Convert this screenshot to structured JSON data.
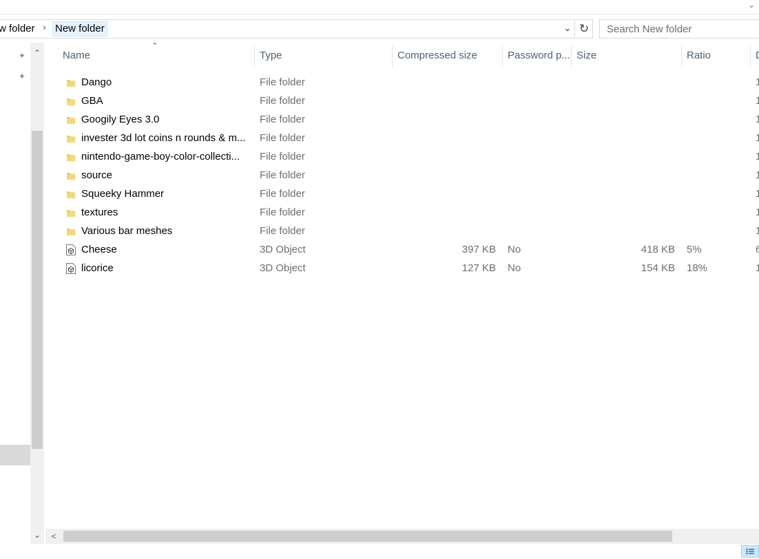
{
  "address": {
    "crumbs": [
      "w folder",
      "New folder"
    ],
    "separator": "›",
    "dropdown_icon": "chevron-down-icon",
    "refresh_icon": "refresh-icon"
  },
  "search": {
    "placeholder": "Search New folder"
  },
  "columns": {
    "name": "Name",
    "type": "Type",
    "compressed": "Compressed size",
    "password": "Password p...",
    "size": "Size",
    "ratio": "Ratio",
    "date": "D"
  },
  "files": [
    {
      "name": "Dango",
      "type": "File folder",
      "compressed": "",
      "password": "",
      "size": "",
      "ratio": "",
      "date": "1",
      "icon": "folder-icon"
    },
    {
      "name": "GBA",
      "type": "File folder",
      "compressed": "",
      "password": "",
      "size": "",
      "ratio": "",
      "date": "1",
      "icon": "folder-icon"
    },
    {
      "name": "Googily Eyes 3.0",
      "type": "File folder",
      "compressed": "",
      "password": "",
      "size": "",
      "ratio": "",
      "date": "1",
      "icon": "folder-icon"
    },
    {
      "name": "invester 3d lot coins n rounds & m...",
      "type": "File folder",
      "compressed": "",
      "password": "",
      "size": "",
      "ratio": "",
      "date": "1",
      "icon": "folder-icon"
    },
    {
      "name": "nintendo-game-boy-color-collecti...",
      "type": "File folder",
      "compressed": "",
      "password": "",
      "size": "",
      "ratio": "",
      "date": "1",
      "icon": "folder-icon"
    },
    {
      "name": "source",
      "type": "File folder",
      "compressed": "",
      "password": "",
      "size": "",
      "ratio": "",
      "date": "1",
      "icon": "folder-icon"
    },
    {
      "name": "Squeeky Hammer",
      "type": "File folder",
      "compressed": "",
      "password": "",
      "size": "",
      "ratio": "",
      "date": "1",
      "icon": "folder-icon"
    },
    {
      "name": "textures",
      "type": "File folder",
      "compressed": "",
      "password": "",
      "size": "",
      "ratio": "",
      "date": "1",
      "icon": "folder-icon"
    },
    {
      "name": "Various bar meshes",
      "type": "File folder",
      "compressed": "",
      "password": "",
      "size": "",
      "ratio": "",
      "date": "1",
      "icon": "folder-icon"
    },
    {
      "name": "Cheese",
      "type": "3D Object",
      "compressed": "397 KB",
      "password": "No",
      "size": "418 KB",
      "ratio": "5%",
      "date": "6",
      "icon": "3d-object-file-icon"
    },
    {
      "name": "licorice",
      "type": "3D Object",
      "compressed": "127 KB",
      "password": "No",
      "size": "154 KB",
      "ratio": "18%",
      "date": "1",
      "icon": "3d-object-file-icon"
    }
  ],
  "colors": {
    "folder": "#f3c94f",
    "header_text": "#4c607a",
    "secondary_text": "#6d6d6d",
    "selection": "#cce8ff"
  }
}
